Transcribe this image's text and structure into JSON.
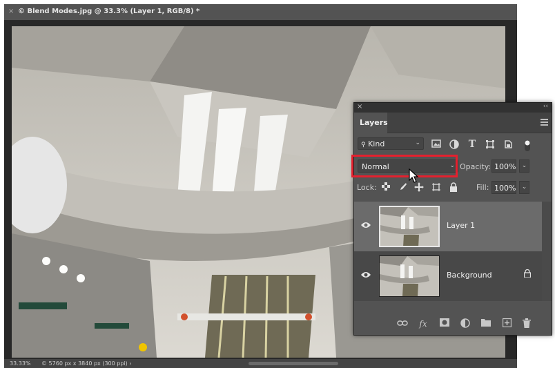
{
  "document": {
    "close_glyph": "×",
    "title": "© Blend Modes.jpg @ 33.3% (Layer 1, RGB/8) *",
    "zoom": "33.33%",
    "info": "© 5760 px x 3840 px (300 ppi)",
    "info_arrow": "›"
  },
  "panel": {
    "close_glyph": "×",
    "collapse_glyph": "‹‹",
    "tab_label": "Layers",
    "filter": {
      "value": "Kind",
      "search_glyph": "🔍"
    },
    "filter_icons": [
      "image-icon",
      "adjustment-icon",
      "type-icon",
      "shape-icon",
      "smart-object-icon",
      "toggle-icon"
    ],
    "type_glyph": "T",
    "blend_mode": "Normal",
    "opacity_label": "Opacity:",
    "opacity_value": "100%",
    "lock_label": "Lock:",
    "fill_label": "Fill:",
    "fill_value": "100%",
    "chevron": "⌄",
    "layers": [
      {
        "name": "Layer 1",
        "selected": true,
        "visible": true,
        "locked": false
      },
      {
        "name": "Background",
        "selected": false,
        "visible": true,
        "locked": true
      }
    ],
    "bottom_icons": [
      "link-icon",
      "fx-icon",
      "mask-icon",
      "fill-adjustment-icon",
      "group-folder-icon",
      "new-layer-icon",
      "trash-icon"
    ],
    "fx_glyph": "fx"
  },
  "colors": {
    "highlight": "#e5202e",
    "panel_bg": "#535353",
    "selected_row": "#6b6b6b"
  }
}
